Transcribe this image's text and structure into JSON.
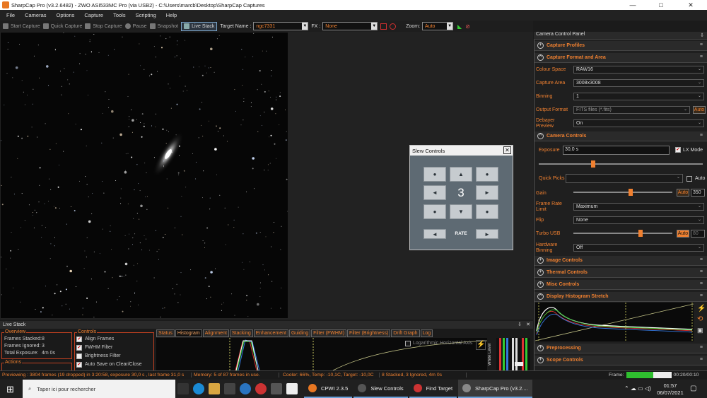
{
  "window": {
    "title": "SharpCap Pro (v3.2.6482) - ZWO ASI533MC Pro (via USB2) - C:\\Users\\marcb\\Desktop\\SharpCap Captures",
    "min": "—",
    "max": "□",
    "close": "✕"
  },
  "menu": [
    "File",
    "Cameras",
    "Options",
    "Capture",
    "Tools",
    "Scripting",
    "Help"
  ],
  "toolbar": {
    "start_capture": "Start Capture",
    "quick_capture": "Quick Capture",
    "stop_capture": "Stop Capture",
    "pause": "Pause",
    "snapshot": "Snapshot",
    "live_stack": "Live Stack",
    "target_label": "Target Name :",
    "target_value": "ngc7331",
    "fx_label": "FX :",
    "fx_value": "None",
    "zoom_label": "Zoom:",
    "zoom_value": "Auto"
  },
  "slew": {
    "title": "Slew Controls",
    "close": "✕",
    "rate_value": "3",
    "rate_label": "RATE",
    "up": "▲",
    "down": "▼",
    "left": "◄",
    "right": "►",
    "dot": "●"
  },
  "panel": {
    "title": "Camera Control Panel",
    "sections": {
      "capture_profiles": "Capture Profiles",
      "capture_format": "Capture Format and Area",
      "camera_controls": "Camera Controls",
      "image_controls": "Image Controls",
      "thermal_controls": "Thermal Controls",
      "misc_controls": "Misc Controls",
      "display_histogram": "Display Histogram Stretch",
      "preprocessing": "Preprocessing",
      "scope_controls": "Scope Controls"
    },
    "colour_space": {
      "label": "Colour Space",
      "value": "RAW16"
    },
    "capture_area": {
      "label": "Capture Area",
      "value": "3008x3008"
    },
    "binning": {
      "label": "Binning",
      "value": "1"
    },
    "output_format": {
      "label": "Output Format",
      "value": "FITS files (*.fits)",
      "auto": "Auto"
    },
    "debayer": {
      "label1": "Debayer",
      "label2": "Preview",
      "value": "On"
    },
    "exposure": {
      "label": "Exposure",
      "value": "30,0 s",
      "lx_label": "LX Mode",
      "slider_fraction": 0.33
    },
    "quick_picks": {
      "label": "Quick Picks",
      "value": "",
      "auto": "Auto"
    },
    "gain": {
      "label": "Gain",
      "auto": "Auto",
      "value": "350",
      "slider_fraction": 0.58
    },
    "frame_rate": {
      "label1": "Frame Rate",
      "label2": "Limit",
      "value": "Maximum"
    },
    "flip": {
      "label": "Flip",
      "value": "None"
    },
    "turbo_usb": {
      "label": "Turbo USB",
      "auto": "Auto",
      "value": "80",
      "slider_fraction": 0.68
    },
    "hardware_binning": {
      "label1": "Hardware",
      "label2": "Binning",
      "value": "Off"
    }
  },
  "live_stack": {
    "title": "Live Stack",
    "overview": {
      "title": "Overview",
      "frames_stacked_label": "Frames Stacked:",
      "frames_stacked": "8",
      "frames_ignored_label": "Frames Ignored:",
      "frames_ignored": "3",
      "total_exposure_label": "Total Exposure:",
      "total_exposure": "4m 0s"
    },
    "controls": {
      "title": "Controls",
      "align": "Align Frames",
      "fwhm": "FWHM Filter",
      "brightness": "Brightness Filter",
      "autosave": "Auto Save on Clear/Close"
    },
    "actions": {
      "title": "Actions"
    },
    "tabs": [
      "Status",
      "Histogram",
      "Alignment",
      "Stacking",
      "Enhancement",
      "Guiding",
      "Filter (FWHM)",
      "Filter (Brightness)",
      "Drift Graph",
      "Log"
    ],
    "active_tab": "Histogram",
    "log_axis": "Logarithmic Horizontal Axis",
    "white_level": "White Level"
  },
  "status": {
    "previewing": "Previewing : 3804 frames (19 dropped) in 3:20:58, exposure 30,0 s , last frame 31,0 s",
    "memory": "Memory: 5 of 87 frames in use.",
    "cooler": "Cooler: 66%, Temp: -10,1C, Target: -10,0C",
    "stack": "8 Stacked, 3 Ignored, 4m 0s",
    "frame_label": "Frame:",
    "frame_fraction": 0.6,
    "frame_time": "00:20/00:10"
  },
  "taskbar": {
    "search": "Taper ici pour rechercher",
    "apps": [
      "CPWI 2.3.5",
      "Slew Controls",
      "Find Target",
      "SharpCap Pro (v3.2...."
    ],
    "time": "01:57",
    "date": "06/07/2021"
  },
  "colors": {
    "accent": "#f08030",
    "frame_bar": "#2fbf2f"
  }
}
